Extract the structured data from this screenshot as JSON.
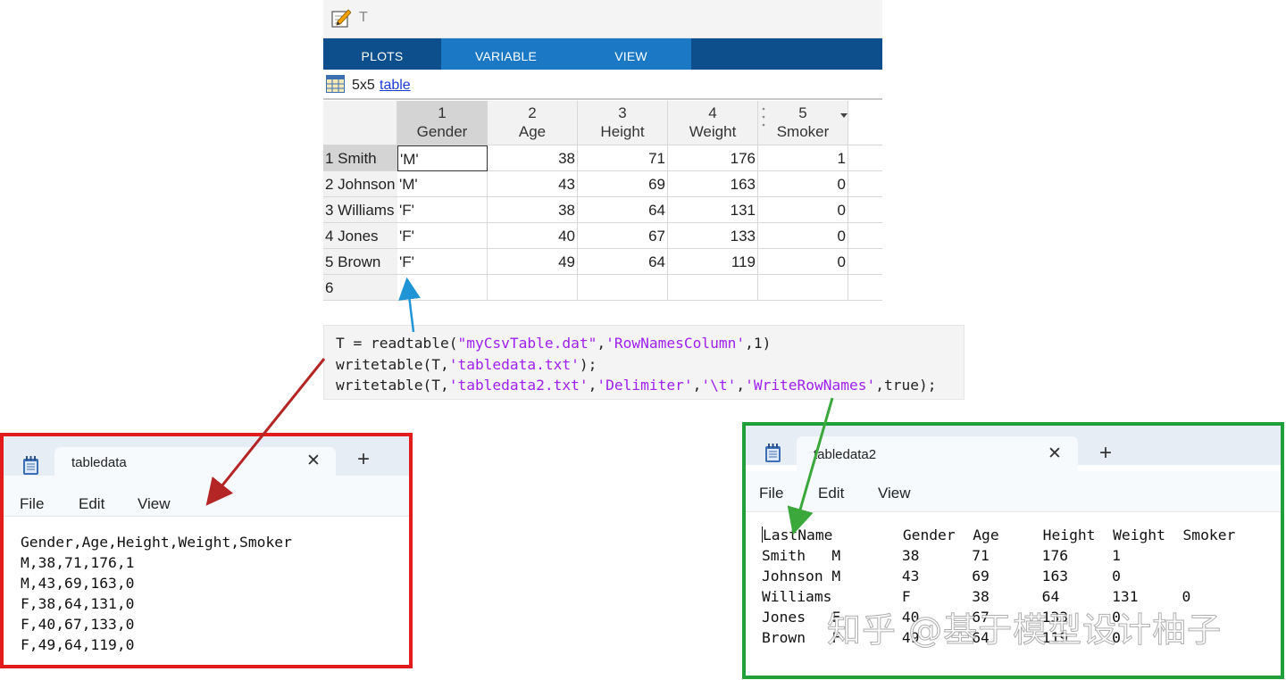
{
  "editor": {
    "title": "T",
    "tabs": [
      "PLOTS",
      "VARIABLE",
      "VIEW"
    ],
    "dims": "5x5",
    "type_link": "table",
    "columns": [
      {
        "num": "1",
        "name": "Gender"
      },
      {
        "num": "2",
        "name": "Age"
      },
      {
        "num": "3",
        "name": "Height"
      },
      {
        "num": "4",
        "name": "Weight"
      },
      {
        "num": "5",
        "name": "Smoker"
      }
    ],
    "rows": [
      {
        "label": "1 Smith",
        "cells": [
          "'M'",
          "38",
          "71",
          "176",
          "1"
        ]
      },
      {
        "label": "2 Johnson",
        "cells": [
          "'M'",
          "43",
          "69",
          "163",
          "0"
        ]
      },
      {
        "label": "3 Williams",
        "cells": [
          "'F'",
          "38",
          "64",
          "131",
          "0"
        ]
      },
      {
        "label": "4 Jones",
        "cells": [
          "'F'",
          "40",
          "67",
          "133",
          "0"
        ]
      },
      {
        "label": "5 Brown",
        "cells": [
          "'F'",
          "49",
          "64",
          "119",
          "0"
        ]
      },
      {
        "label": "6",
        "cells": [
          "",
          "",
          "",
          "",
          ""
        ]
      }
    ]
  },
  "code": {
    "lines": [
      [
        {
          "t": "T = readtable(",
          "s": false
        },
        {
          "t": "\"myCsvTable.dat\"",
          "s": true
        },
        {
          "t": ",",
          "s": false
        },
        {
          "t": "'RowNamesColumn'",
          "s": true
        },
        {
          "t": ",1)",
          "s": false
        }
      ],
      [
        {
          "t": "writetable(T,",
          "s": false
        },
        {
          "t": "'tabledata.txt'",
          "s": true
        },
        {
          "t": ");",
          "s": false
        }
      ],
      [
        {
          "t": "writetable(T,",
          "s": false
        },
        {
          "t": "'tabledata2.txt'",
          "s": true
        },
        {
          "t": ",",
          "s": false
        },
        {
          "t": "'Delimiter'",
          "s": true
        },
        {
          "t": ",",
          "s": false
        },
        {
          "t": "'\\t'",
          "s": true
        },
        {
          "t": ",",
          "s": false
        },
        {
          "t": "'WriteRowNames'",
          "s": true
        },
        {
          "t": ",true);",
          "s": false
        }
      ]
    ]
  },
  "notepad1": {
    "tab_title": "tabledata",
    "close": "✕",
    "new_tab": "+",
    "menu": [
      "File",
      "Edit",
      "View"
    ],
    "lines": [
      "Gender,Age,Height,Weight,Smoker",
      "M,38,71,176,1",
      "M,43,69,163,0",
      "F,38,64,131,0",
      "F,40,67,133,0",
      "F,49,64,119,0"
    ]
  },
  "notepad2": {
    "tab_title": "tabledata2",
    "close": "✕",
    "new_tab": "+",
    "menu": [
      "File",
      "Edit",
      "View"
    ],
    "lines": [
      "LastName        Gender  Age     Height  Weight  Smoker",
      "Smith   M       38      71      176     1",
      "Johnson M       43      69      163     0",
      "Williams        F       38      64      131     0",
      "Jones   F       40      67      133     0",
      "Brown   F       49      64      119     0"
    ]
  },
  "watermark": "知乎 @基于模型设计柚子",
  "colors": {
    "tabbar_dark": "#0c4f8c",
    "tabbar_light": "#1b78c4",
    "string": "#a020f0",
    "frame_red": "#e21b1b",
    "frame_green": "#1fa03a",
    "arrow_blue": "#1f95d6",
    "arrow_red": "#b42626",
    "arrow_green": "#3aa83a"
  },
  "icons": [
    "pencil-icon",
    "table-grid-icon",
    "notepad-icon",
    "close-icon",
    "plus-icon",
    "column-menu-icon"
  ]
}
